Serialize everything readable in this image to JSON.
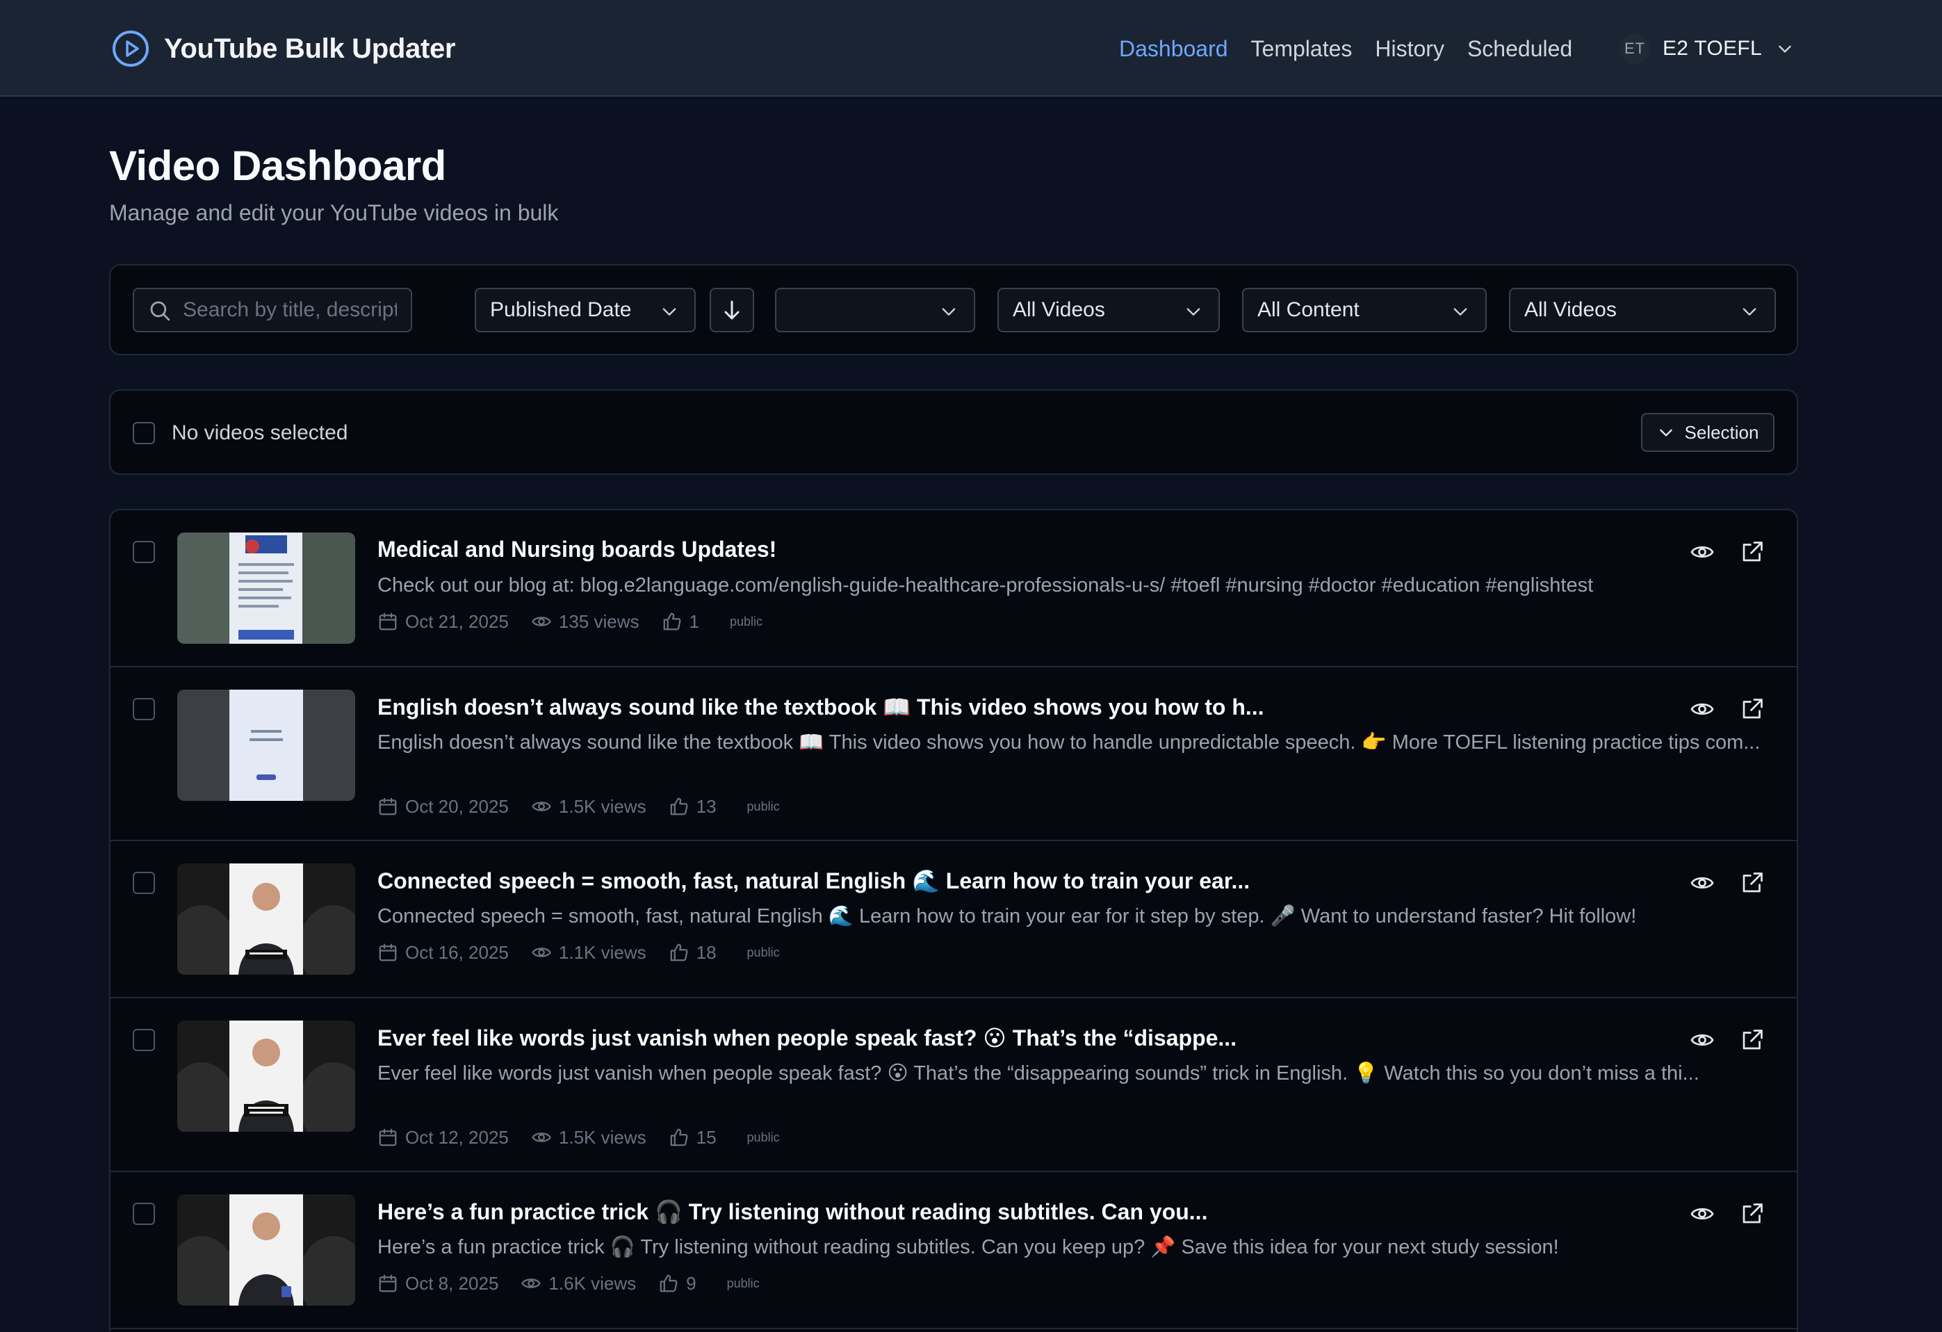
{
  "app": {
    "title": "YouTube Bulk Updater"
  },
  "nav": {
    "items": [
      {
        "label": "Dashboard",
        "active": true
      },
      {
        "label": "Templates"
      },
      {
        "label": "History"
      },
      {
        "label": "Scheduled"
      }
    ]
  },
  "user": {
    "initials": "ET",
    "name": "E2 TOEFL"
  },
  "page": {
    "title": "Video Dashboard",
    "subtitle": "Manage and edit your YouTube videos in bulk"
  },
  "filters": {
    "search_placeholder": "Search by title, descripti",
    "sort_by": "Published Date",
    "blank_select": "",
    "filter1": "All Videos",
    "filter2": "All Content",
    "filter3": "All Videos"
  },
  "selection": {
    "status": "No videos selected",
    "button": "Selection"
  },
  "videos": [
    {
      "title": "Medical and Nursing boards Updates!",
      "description": "Check out our blog at: blog.e2language.com/english-guide-healthcare-professionals-u-s/ #toefl #nursing #doctor #education #englishtest",
      "date": "Oct 21, 2025",
      "views": "135 views",
      "likes": "1",
      "visibility": "public"
    },
    {
      "title": "English doesn’t always sound like the textbook 📖 This video shows you how to h...",
      "description": "English doesn’t always sound like the textbook 📖 This video shows you how to handle unpredictable speech. 👉 More TOEFL listening practice tips com...",
      "date": "Oct 20, 2025",
      "views": "1.5K views",
      "likes": "13",
      "visibility": "public"
    },
    {
      "title": "Connected speech = smooth, fast, natural English 🌊 Learn how to train your ear...",
      "description": "Connected speech = smooth, fast, natural English 🌊 Learn how to train your ear for it step by step. 🎤 Want to understand faster? Hit follow!",
      "date": "Oct 16, 2025",
      "views": "1.1K views",
      "likes": "18",
      "visibility": "public"
    },
    {
      "title": "Ever feel like words just vanish when people speak fast? 😮 That’s the “disappe...",
      "description": "Ever feel like words just vanish when people speak fast? 😮 That’s the “disappearing sounds” trick in English. 💡 Watch this so you don’t miss a thi...",
      "date": "Oct 12, 2025",
      "views": "1.5K views",
      "likes": "15",
      "visibility": "public"
    },
    {
      "title": "Here’s a fun practice trick 🎧 Try listening without reading subtitles. Can you...",
      "description": "Here’s a fun practice trick 🎧 Try listening without reading subtitles. Can you keep up? 📌 Save this idea for your next study session!",
      "date": "Oct 8, 2025",
      "views": "1.6K views",
      "likes": "9",
      "visibility": "public"
    }
  ],
  "colors": {
    "accent": "#6ea8fe",
    "background": "#0b1120",
    "panel": "#05080f",
    "header": "#1b2433"
  }
}
